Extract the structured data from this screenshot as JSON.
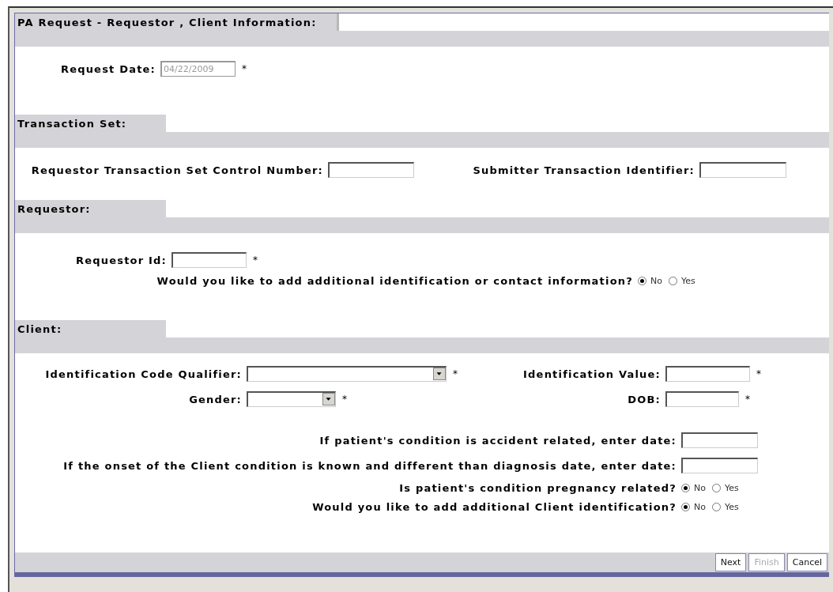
{
  "title": "PA Request - Requestor , Client Information:",
  "request_date": {
    "label": "Request Date:",
    "value": "04/22/2009",
    "disabled": true,
    "mark": "*"
  },
  "transaction_set": {
    "heading": "Transaction Set:",
    "fields": [
      {
        "label": "Requestor Transaction Set Control Number:"
      },
      {
        "label": "Submitter Transaction Identifier:"
      }
    ]
  },
  "requestor": {
    "heading": "Requestor:",
    "requestor_id": {
      "label": "Requestor Id:",
      "mark": "*"
    },
    "additional": {
      "question": "Would you like to add additional identification or contact information?",
      "options": [
        {
          "label": "No",
          "selected": true
        },
        {
          "label": "Yes",
          "selected": false
        }
      ]
    }
  },
  "client": {
    "heading": "Client:",
    "fields": [
      {
        "kind": "select",
        "label": "Identification Code Qualifier:",
        "mark": "*"
      },
      {
        "kind": "text",
        "label": "Identification Value:",
        "mark": "*"
      },
      {
        "kind": "select",
        "label": "Gender:",
        "mark": "*"
      },
      {
        "kind": "text",
        "label": "DOB:",
        "mark": "*"
      }
    ],
    "questions": [
      {
        "kind": "date",
        "label": "If patient's condition is accident related, enter date:"
      },
      {
        "kind": "date",
        "label": "If the onset of the Client condition is known and different than diagnosis date, enter date:"
      },
      {
        "kind": "radio",
        "label": "Is patient's condition pregnancy related?",
        "options": [
          {
            "label": "No",
            "selected": true
          },
          {
            "label": "Yes",
            "selected": false
          }
        ]
      },
      {
        "kind": "radio",
        "label": "Would you like to add additional Client identification?",
        "options": [
          {
            "label": "No",
            "selected": true
          },
          {
            "label": "Yes",
            "selected": false
          }
        ]
      }
    ]
  },
  "buttons": [
    {
      "label": "Next",
      "disabled": false
    },
    {
      "label": "Finish",
      "disabled": true
    },
    {
      "label": "Cancel",
      "disabled": false
    }
  ]
}
